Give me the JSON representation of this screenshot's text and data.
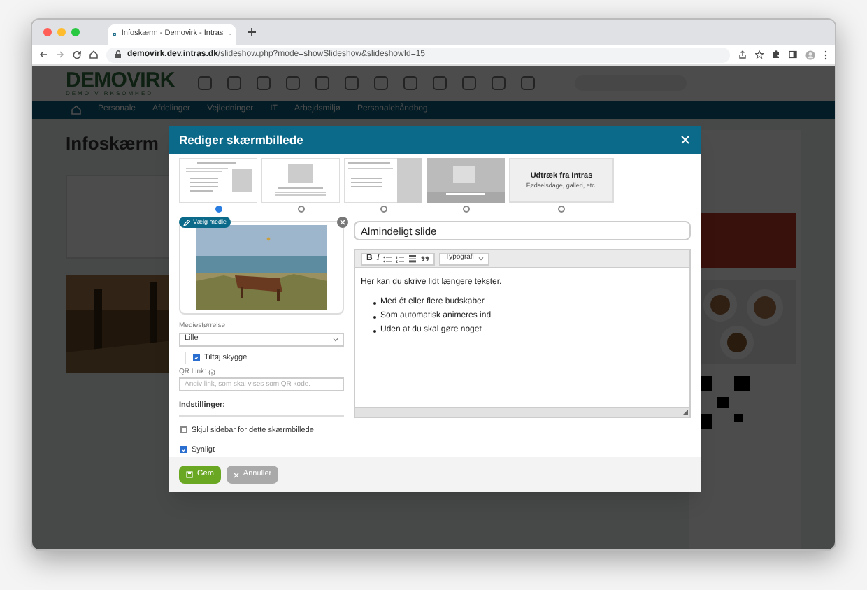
{
  "browser": {
    "tab_title": "Infoskærm - Demovirk - Intras",
    "url_host": "demovirk.dev.intras.dk",
    "url_path": "/slideshow.php?mode=showSlideshow&slideshowId=15"
  },
  "page": {
    "logo": "DEMOVIRK",
    "logo_sub": "DEMO VIRKSOMHED",
    "nav": [
      "Personale",
      "Afdelinger",
      "Vejledninger",
      "IT",
      "Arbejdsmiljø",
      "Personalehåndbog"
    ],
    "heading": "Infoskærm"
  },
  "dialog": {
    "title": "Rediger skærmbillede",
    "layouts": [
      {
        "kind": "text-image",
        "selected": true
      },
      {
        "kind": "image-top",
        "selected": false
      },
      {
        "kind": "text-image-full",
        "selected": false
      },
      {
        "kind": "image-full",
        "selected": false
      },
      {
        "kind": "extract",
        "selected": false,
        "label": "Udtræk fra Intras",
        "sublabel": "Fødselsdage, galleri, etc."
      }
    ],
    "media_button": "Vælg medie",
    "media_size_label": "Mediestørrelse",
    "media_size": "Lille",
    "shadow": {
      "label": "Tilføj skygge",
      "checked": true
    },
    "qr_label": "QR Link:",
    "qr_placeholder": "Angiv link, som skal vises som QR kode.",
    "settings_label": "Indstillinger:",
    "options": [
      {
        "label": "Skjul sidebar for dette skærmbillede",
        "checked": false
      },
      {
        "label": "Synligt",
        "checked": true
      }
    ],
    "slide_title": "Almindeligt slide",
    "format_buttons": [
      "B",
      "I"
    ],
    "style_select": "Typografi",
    "body": "Her kan du skrive lidt længere tekster.",
    "bullets": [
      "Med ét eller flere budskaber",
      "Som automatisk animeres ind",
      "Uden at du skal gøre noget"
    ],
    "save": "Gem",
    "cancel": "Annuller"
  }
}
